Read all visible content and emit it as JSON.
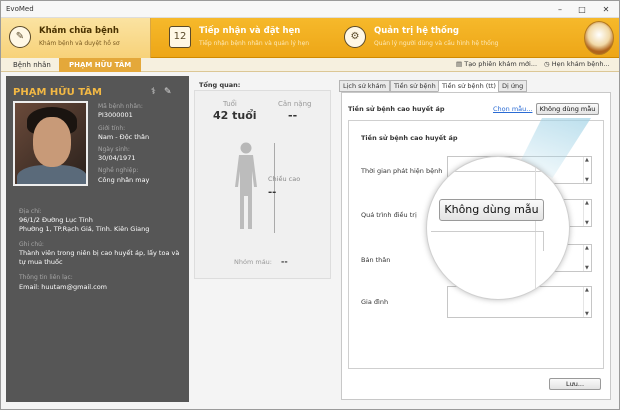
{
  "window": {
    "title": "EvoMed"
  },
  "ribbon": [
    {
      "title": "Khám chữa bệnh",
      "sub": "Khám bệnh và duyệt hồ sơ",
      "icon": "clipboard-icon"
    },
    {
      "title": "Tiếp nhận và đặt hẹn",
      "sub": "Tiếp nhận bệnh nhân và quản lý hẹn",
      "icon": "calendar-icon"
    },
    {
      "title": "Quản trị hệ thống",
      "sub": "Quản lý người dùng và cấu hình hệ thống",
      "icon": "gear-icon"
    }
  ],
  "breadcrumb": {
    "root": "Bệnh nhân",
    "current": "PHẠM HỮU TÂM"
  },
  "sublinks": {
    "close_session": "Tạo phiên khám mới...",
    "schedule": "Hẹn khám bệnh..."
  },
  "patient": {
    "name": "PHẠM HỮU TÂM",
    "id_label": "Mã bệnh nhân:",
    "id": "PI3000001",
    "gender_label": "Giới tính:",
    "gender": "Nam - Độc thân",
    "dob_label": "Ngày sinh:",
    "dob": "30/04/1971",
    "job_label": "Nghề nghiệp:",
    "job": "Công nhân may",
    "addr_label": "Địa chỉ:",
    "addr1": "96/1/2 Đường Lục Tỉnh",
    "addr2": "Phường 1, TP.Rạch Giá, Tỉnh. Kiên Giang",
    "note_label": "Ghi chú:",
    "note1": "Thành viên trong niên bị cao huyết áp, lấy toa và",
    "note2": "tự mua thuốc",
    "contact_label": "Thông tin liên lạc:",
    "email": "Email: huutam@gmail.com"
  },
  "overview": {
    "title": "Tổng quan:",
    "age_label": "Tuổi",
    "age": "42 tuổi",
    "weight_label": "Cân nặng",
    "weight": "--",
    "height_label": "Chiều cao",
    "height": "--",
    "blood_label": "Nhóm máu:",
    "blood": "--"
  },
  "tabs": [
    "Lịch sử khám",
    "Tiền sử bệnh",
    "Tiền sử bệnh (tt)",
    "Dị ứng"
  ],
  "panel": {
    "title": "Tiền sử bệnh cao huyết áp",
    "choose_link": "Chọn mẫu...",
    "nouse_btn": "Không dùng mẫu",
    "inner_title": "Tiền sử bệnh cao huyết áp",
    "fields": [
      "Thời gian phát hiện bệnh",
      "Quá trình điều trị",
      "Bản thân",
      "Gia đình"
    ],
    "save_btn": "Lưu...",
    "magnified_btn": "Không dùng mẫu"
  },
  "colors": {
    "ribbon": "#eda617",
    "sidebar": "#565656",
    "name": "#f2b844"
  }
}
